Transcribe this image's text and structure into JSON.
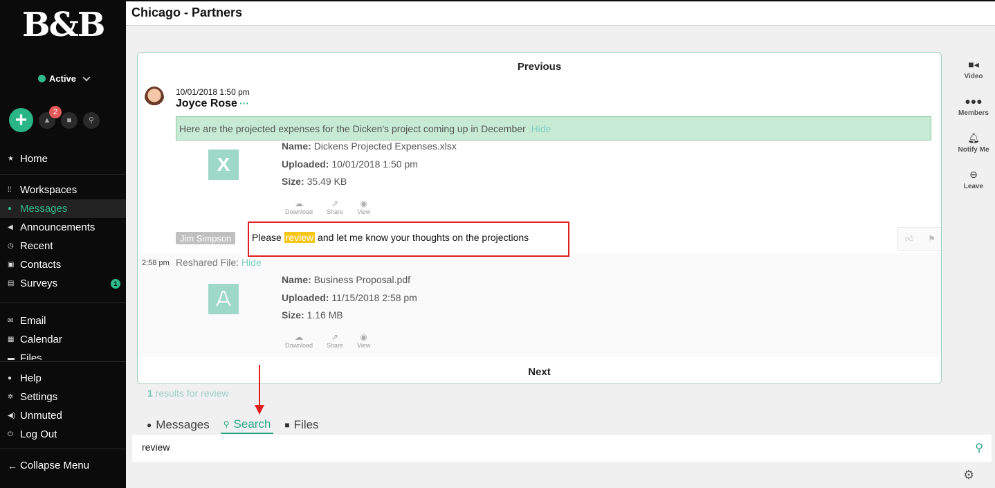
{
  "sidebar": {
    "logo": "B&B",
    "status": "Active",
    "alerts_badge": "2",
    "nav_primary": [
      {
        "label": "Home"
      }
    ],
    "nav_main": [
      {
        "label": "Workspaces"
      },
      {
        "label": "Messages"
      },
      {
        "label": "Announcements"
      },
      {
        "label": "Recent"
      },
      {
        "label": "Contacts"
      },
      {
        "label": "Surveys",
        "badge": "1"
      }
    ],
    "nav_tools": [
      {
        "label": "Email"
      },
      {
        "label": "Calendar"
      },
      {
        "label": "Files"
      }
    ],
    "nav_bottom": [
      {
        "label": "Help"
      },
      {
        "label": "Settings"
      },
      {
        "label": "Unmuted"
      },
      {
        "label": "Log Out"
      }
    ],
    "collapse": "Collapse Menu"
  },
  "header": {
    "title": "Chicago - Partners"
  },
  "rail": [
    {
      "label": "Video",
      "icon": "video-icon"
    },
    {
      "label": "Members",
      "icon": "members-icon"
    },
    {
      "label": "Notify Me",
      "icon": "bell-icon"
    },
    {
      "label": "Leave",
      "icon": "leave-icon"
    }
  ],
  "panel": {
    "previous": "Previous",
    "next": "Next",
    "message": {
      "timestamp": "10/01/2018 1:50 pm",
      "author": "Joyce Rose",
      "author_menu": "···",
      "text": "Here are the projected expenses for the Dicken's project coming up in December",
      "hide": "Hide"
    },
    "file1": {
      "name_label": "Name:",
      "name": "Dickens Projected Expenses.xlsx",
      "uploaded_label": "Uploaded:",
      "uploaded": "10/01/2018 1:50 pm",
      "size_label": "Size:",
      "size": "35.49 KB",
      "icon_glyph": "X"
    },
    "actions": {
      "download": "Download",
      "share": "Share",
      "view": "View"
    },
    "reply": {
      "author": "Jim Simpson",
      "before": "Please ",
      "keyword": "review",
      "after": " and let me know your thoughts on the projections"
    },
    "reshared": {
      "time": "2:58 pm",
      "label": "Reshared File:",
      "hide": "Hide"
    },
    "file2": {
      "name_label": "Name:",
      "name": "Business Proposal.pdf",
      "uploaded_label": "Uploaded:",
      "uploaded": "11/15/2018 2:58 pm",
      "size_label": "Size:",
      "size": "1.16 MB"
    }
  },
  "results": {
    "count": "1",
    "text": " results for review"
  },
  "tabs": [
    {
      "label": "Messages"
    },
    {
      "label": "Search"
    },
    {
      "label": "Files"
    }
  ],
  "search": {
    "value": "review"
  },
  "colors": {
    "accent": "#2aa884",
    "highlight": "#f5c518",
    "annotation": "#e02020"
  }
}
